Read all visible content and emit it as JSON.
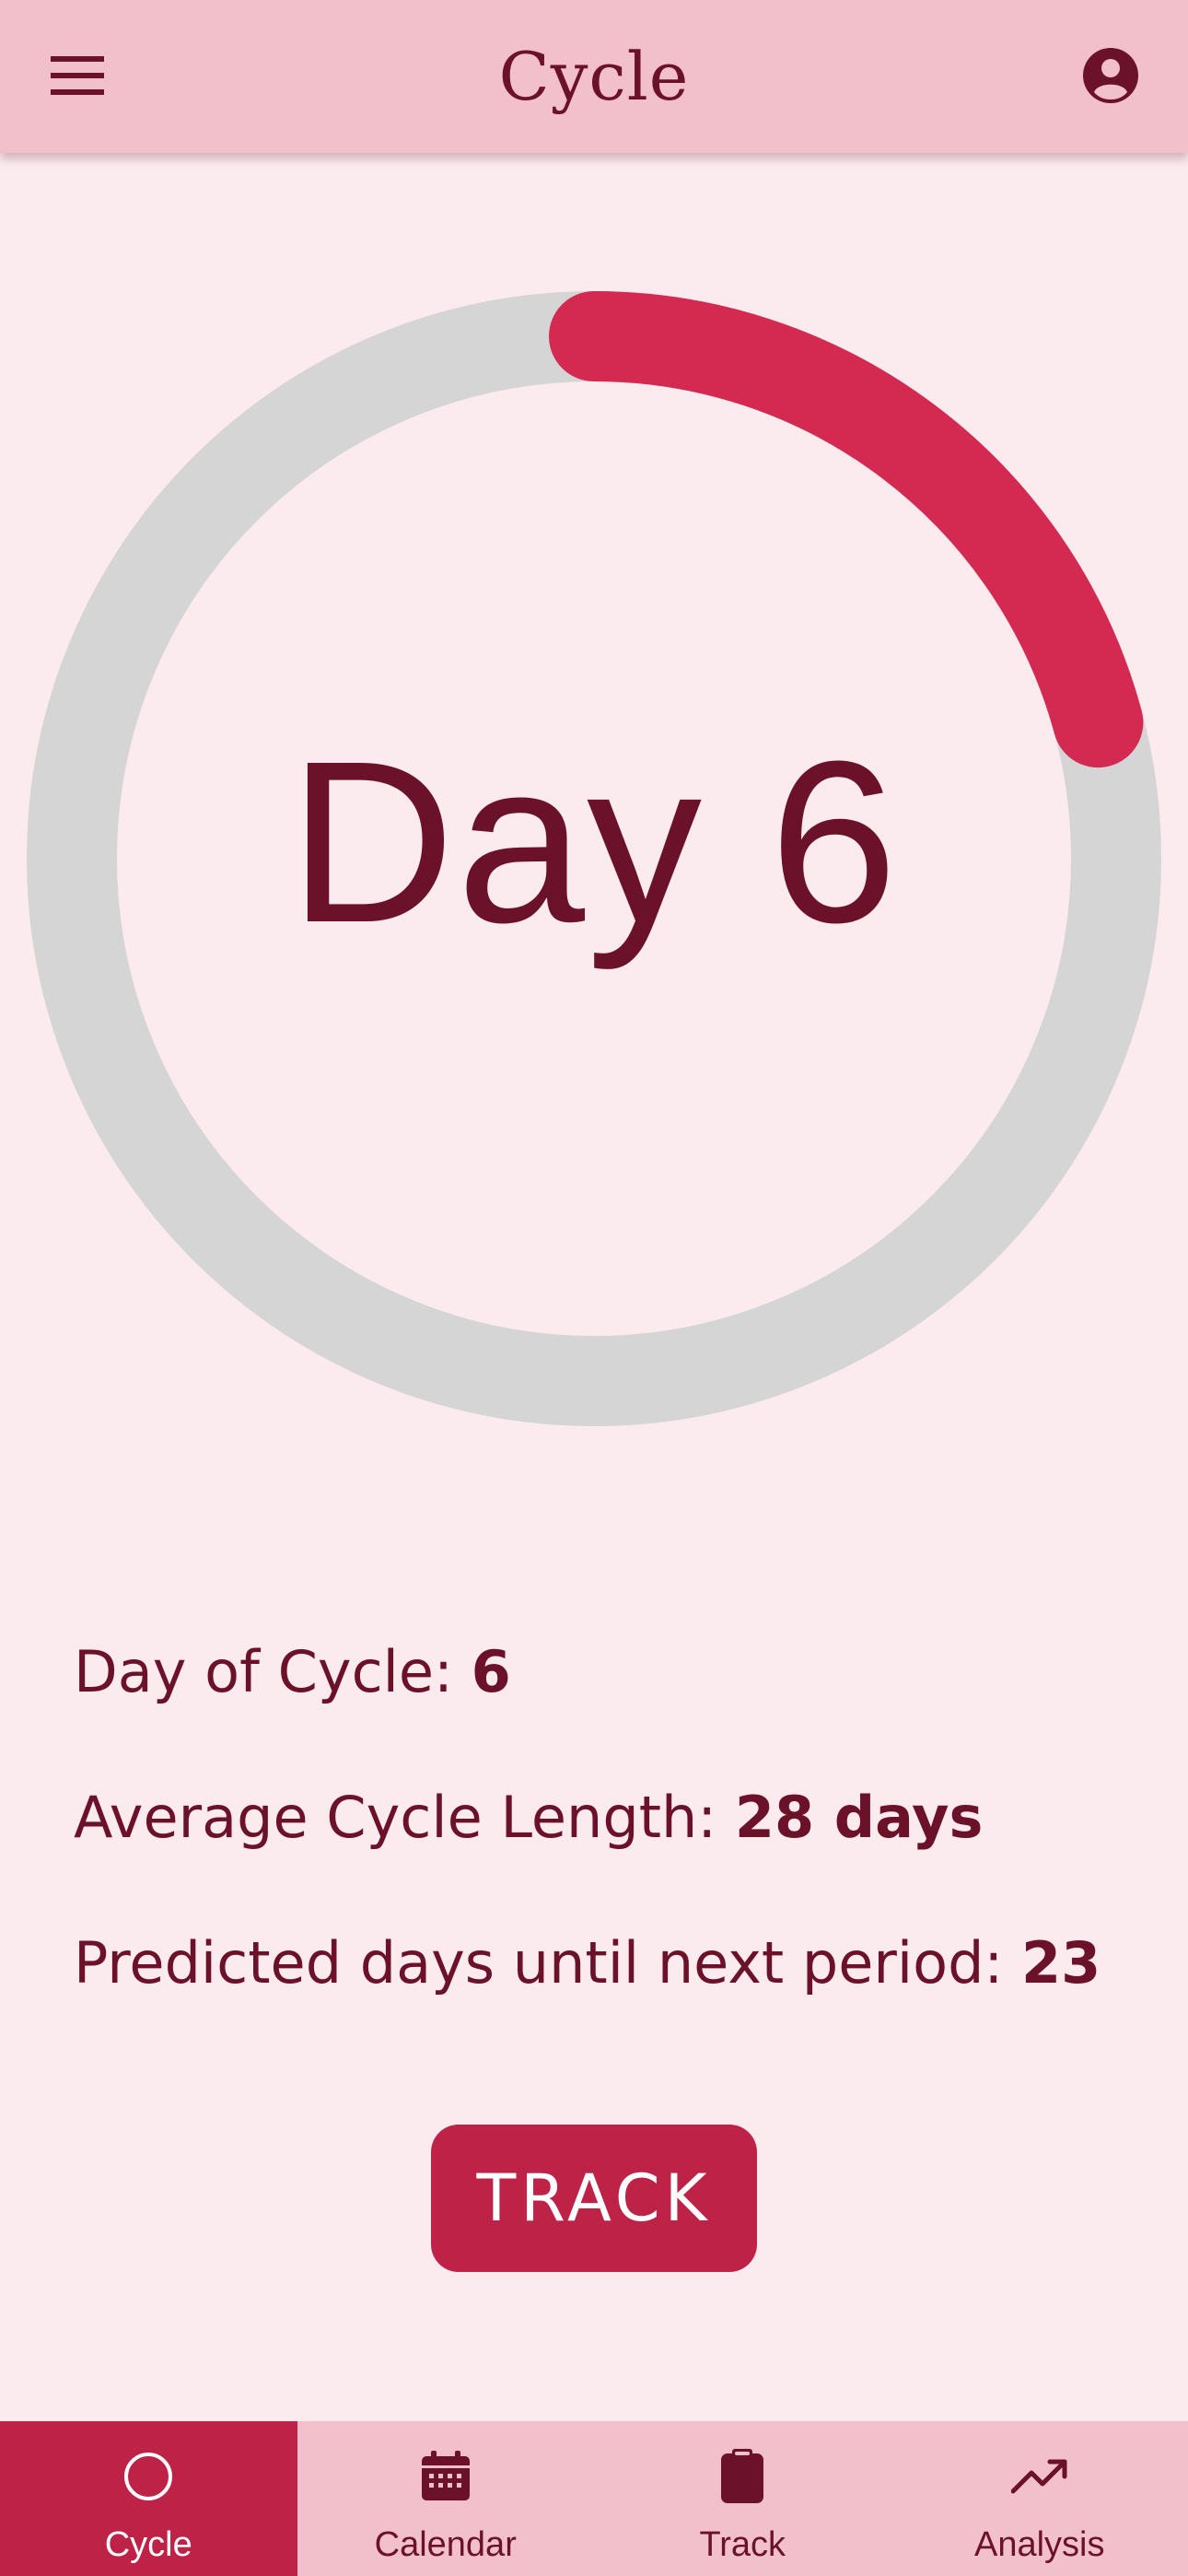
{
  "app_bar": {
    "title": "Cycle",
    "menu_icon": "hamburger-menu-icon",
    "profile_icon": "account-circle-icon"
  },
  "cycle_ring": {
    "day_label": "Day 6",
    "progress_fraction": 0.208,
    "track_color": "#d5d5d5",
    "progress_color": "#d42a52"
  },
  "stats": {
    "day_of_cycle_label": "Day of Cycle: ",
    "day_of_cycle_value": "6",
    "avg_cycle_length_label": "Average Cycle Length: ",
    "avg_cycle_length_value": "28 days",
    "predicted_days_label": "Predicted days until next period: ",
    "predicted_days_value": "23"
  },
  "track_button": {
    "label": "TRACK"
  },
  "bottom_nav": {
    "items": [
      {
        "label": "Cycle",
        "icon": "circle-outline-icon",
        "active": true
      },
      {
        "label": "Calendar",
        "icon": "calendar-icon",
        "active": false
      },
      {
        "label": "Track",
        "icon": "clipboard-icon",
        "active": false
      },
      {
        "label": "Analysis",
        "icon": "trending-up-icon",
        "active": false
      }
    ]
  },
  "colors": {
    "background": "#fbebee",
    "app_bar": "#f2c0cb",
    "accent": "#be2246",
    "text": "#6b1129"
  }
}
